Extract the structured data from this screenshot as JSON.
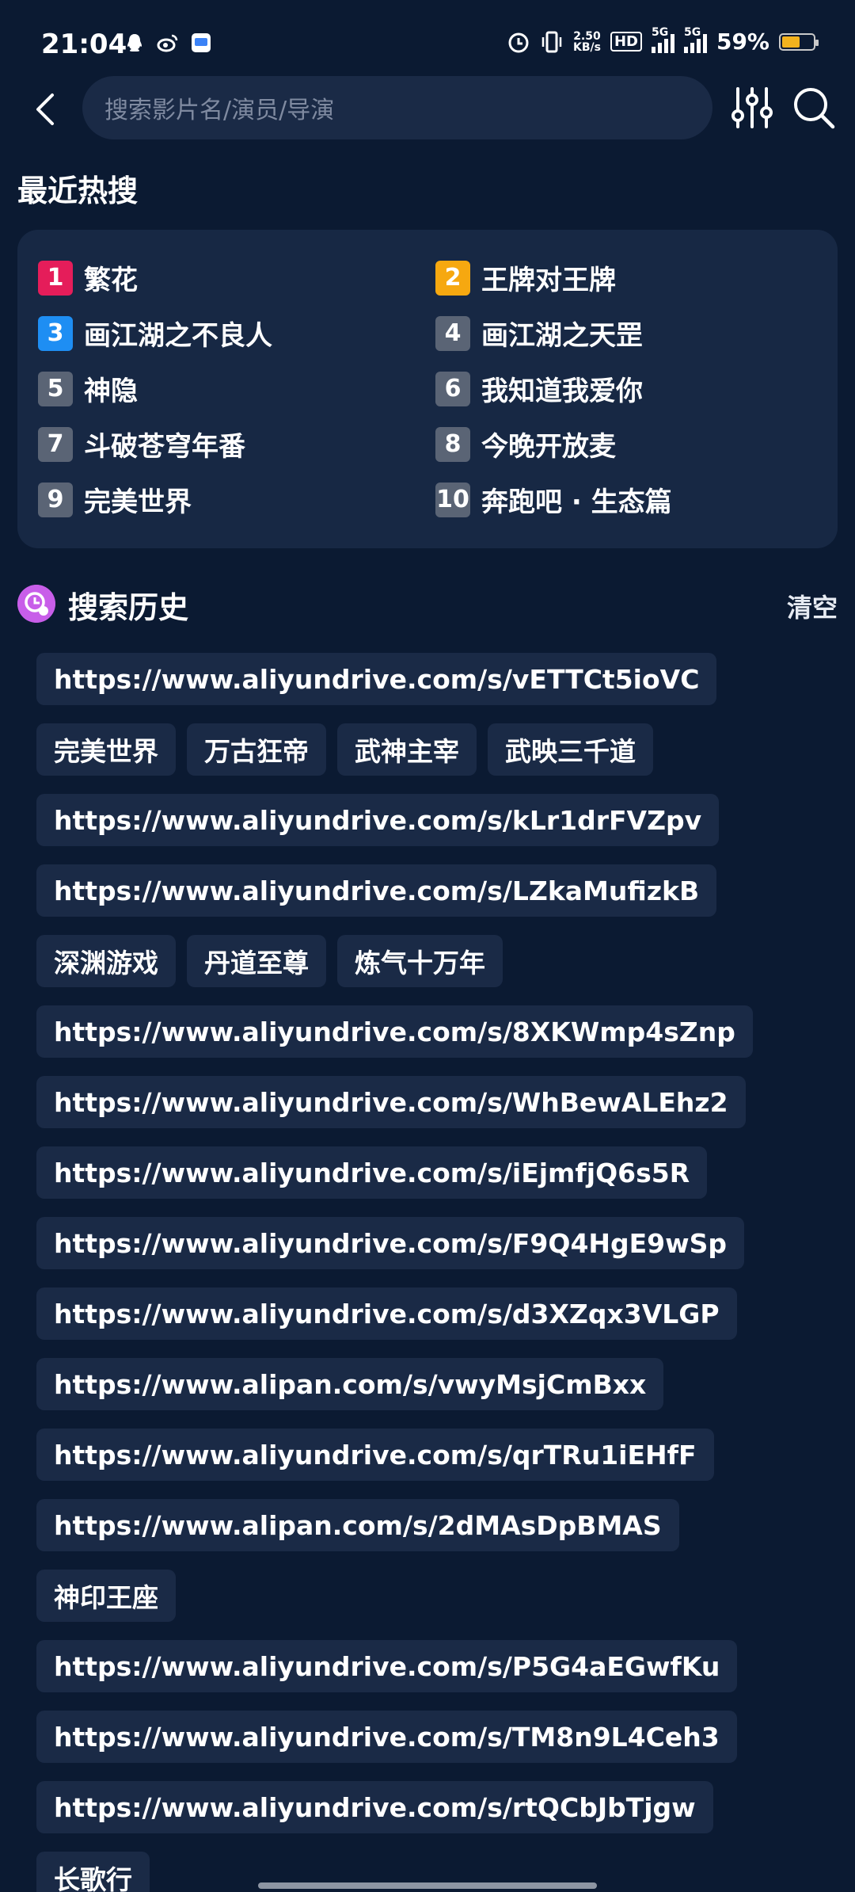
{
  "status": {
    "time": "21:04",
    "net_speed_value": "2.50",
    "net_speed_unit": "KB/s",
    "hd_label": "HD",
    "sim1": "5G",
    "sim2": "5G",
    "battery": "59%",
    "battery_level": 0.59,
    "battery_color": "#f2b21e"
  },
  "search": {
    "placeholder": "搜索影片名/演员/导演"
  },
  "hot": {
    "title": "最近热搜",
    "items": [
      {
        "rank": "1",
        "name": "繁花"
      },
      {
        "rank": "2",
        "name": "王牌对王牌"
      },
      {
        "rank": "3",
        "name": "画江湖之不良人"
      },
      {
        "rank": "4",
        "name": "画江湖之天罡"
      },
      {
        "rank": "5",
        "name": "神隐"
      },
      {
        "rank": "6",
        "name": "我知道我爱你"
      },
      {
        "rank": "7",
        "name": "斗破苍穹年番"
      },
      {
        "rank": "8",
        "name": "今晚开放麦"
      },
      {
        "rank": "9",
        "name": "完美世界"
      },
      {
        "rank": "10",
        "name": "奔跑吧 · 生态篇"
      }
    ],
    "rank_colors": {
      "1": "#e51d5a",
      "2": "#f6a810",
      "3": "#1e8ef3",
      "other": "#5a6475"
    }
  },
  "history": {
    "title": "搜索历史",
    "clear_label": "清空",
    "items": [
      "https://www.aliyundrive.com/s/vETTCt5ioVC",
      "完美世界",
      "万古狂帝",
      "武神主宰",
      "武映三千道",
      "https://www.aliyundrive.com/s/kLr1drFVZpv",
      "https://www.aliyundrive.com/s/LZkaMufizkB",
      "深渊游戏",
      "丹道至尊",
      "炼气十万年",
      "https://www.aliyundrive.com/s/8XKWmp4sZnp",
      "https://www.aliyundrive.com/s/WhBewALEhz2",
      "https://www.aliyundrive.com/s/iEjmfjQ6s5R",
      "https://www.aliyundrive.com/s/F9Q4HgE9wSp",
      "https://www.aliyundrive.com/s/d3XZqx3VLGP",
      "https://www.alipan.com/s/vwyMsjCmBxx",
      "https://www.aliyundrive.com/s/qrTRu1iEHfF",
      "https://www.alipan.com/s/2dMAsDpBMAS",
      "神印王座",
      "https://www.aliyundrive.com/s/P5G4aEGwfKu",
      "https://www.aliyundrive.com/s/TM8n9L4Ceh3",
      "https://www.aliyundrive.com/s/rtQCbJbTjgw",
      "长歌行"
    ]
  }
}
